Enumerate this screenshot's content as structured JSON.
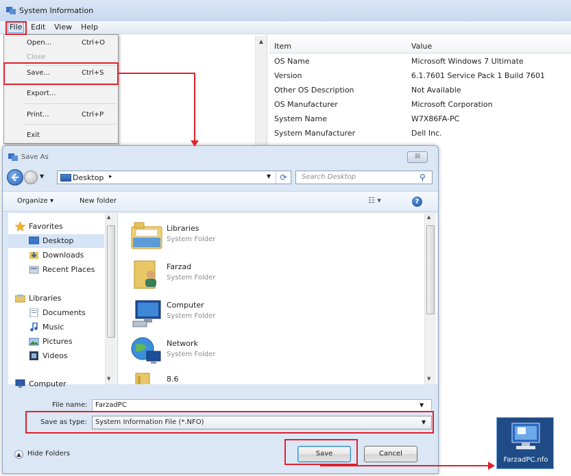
{
  "system_info": {
    "title": "System Information",
    "menu": [
      "File",
      "Edit",
      "View",
      "Help"
    ],
    "file_menu": [
      {
        "label": "Open...",
        "shortcut": "Ctrl+O",
        "enabled": true
      },
      {
        "label": "Close",
        "shortcut": "",
        "enabled": false
      },
      {
        "label": "Save...",
        "shortcut": "Ctrl+S",
        "enabled": true
      },
      {
        "label": "Export...",
        "shortcut": "",
        "enabled": true
      },
      {
        "label": "Print...",
        "shortcut": "Ctrl+P",
        "enabled": true
      },
      {
        "label": "Exit",
        "shortcut": "",
        "enabled": true
      }
    ],
    "table": {
      "headers": [
        "Item",
        "Value"
      ],
      "rows": [
        [
          "OS Name",
          "Microsoft Windows 7 Ultimate"
        ],
        [
          "Version",
          "6.1.7601 Service Pack 1 Build 7601"
        ],
        [
          "Other OS Description",
          "Not Available"
        ],
        [
          "OS Manufacturer",
          "Microsoft Corporation"
        ],
        [
          "System Name",
          "W7X86FA-PC"
        ],
        [
          "System Manufacturer",
          "Dell Inc."
        ]
      ]
    }
  },
  "save_as": {
    "title": "Save As",
    "close_glyph": "☒",
    "address": {
      "location": "Desktop",
      "separator": "▸"
    },
    "search": {
      "placeholder": "Search Desktop"
    },
    "toolbar": {
      "organize": "Organize ▾",
      "new_folder": "New folder",
      "views": "☷ ▾",
      "help": "?"
    },
    "nav_pane": [
      {
        "label": "Favorites",
        "icon": "star-icon"
      },
      {
        "label": "Desktop",
        "icon": "desktop-icon"
      },
      {
        "label": "Downloads",
        "icon": "downloads-icon"
      },
      {
        "label": "Recent Places",
        "icon": "recent-places-icon"
      },
      {
        "label": "Libraries",
        "icon": "libraries-icon"
      },
      {
        "label": "Documents",
        "icon": "documents-icon"
      },
      {
        "label": "Music",
        "icon": "music-icon"
      },
      {
        "label": "Pictures",
        "icon": "pictures-icon"
      },
      {
        "label": "Videos",
        "icon": "videos-icon"
      },
      {
        "label": "Computer",
        "icon": "computer-icon"
      }
    ],
    "files": [
      {
        "name": "Libraries",
        "type": "System Folder",
        "icon": "libraries-folder-icon"
      },
      {
        "name": "Farzad",
        "type": "System Folder",
        "icon": "user-folder-icon"
      },
      {
        "name": "Computer",
        "type": "System Folder",
        "icon": "computer-icon"
      },
      {
        "name": "Network",
        "type": "System Folder",
        "icon": "network-icon"
      },
      {
        "name": "8.6",
        "type": "",
        "icon": "folder-icon"
      }
    ],
    "file_name_label": "File name:",
    "file_name_value": "FarzadPC",
    "save_type_label": "Save as type:",
    "save_type_value": "System Information File (*.NFO)",
    "hide_folders": "Hide Folders",
    "save_button": "Save",
    "cancel_button": "Cancel"
  },
  "output_file": {
    "label": "FarzadPC.nfo",
    "icon": "nfo-file-icon"
  },
  "colors": {
    "highlight": "#e0202a",
    "accent": "#2a62b5"
  }
}
